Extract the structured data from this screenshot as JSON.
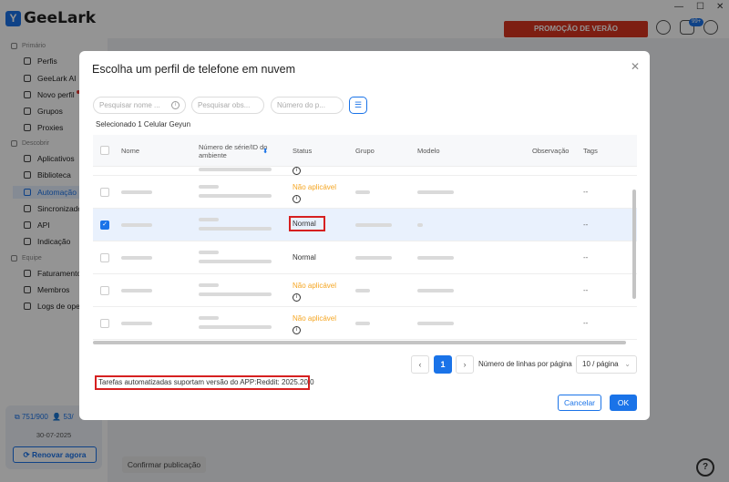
{
  "app": {
    "logo_text": "GeeLark",
    "promo_label": "PROMOÇÃO DE VERÃO",
    "notification_badge": "99+"
  },
  "sidebar": {
    "sections": [
      {
        "label": "Primário",
        "items": [
          "Perfis",
          "GeeLark AI",
          "Novo perfil",
          "Grupos",
          "Proxies"
        ]
      },
      {
        "label": "Descobrir",
        "items": [
          "Aplicativos",
          "Biblioteca",
          "Automação",
          "Sincronizador",
          "API",
          "Indicação"
        ]
      },
      {
        "label": "Equipe",
        "items": [
          "Faturamento",
          "Membros",
          "Logs de operações"
        ]
      }
    ],
    "quota_left": "751/900",
    "quota_right": "53/",
    "date": "30-07-2025",
    "renew_label": "Renovar agora"
  },
  "background": {
    "confirm_label": "Confirmar publicação"
  },
  "modal": {
    "title": "Escolha um perfil de telefone em nuvem",
    "filters": {
      "name_placeholder": "Pesquisar nome ...",
      "obs_placeholder": "Pesquisar obs...",
      "number_placeholder": "Número do p..."
    },
    "selected_text": "Selecionado 1 Celular Geyun",
    "columns": {
      "name": "Nome",
      "serial": "Número de série/ID do ambiente",
      "status": "Status",
      "group": "Grupo",
      "model": "Modelo",
      "observation": "Observação",
      "tags": "Tags"
    },
    "rows": [
      {
        "status": "Não aplicável",
        "status_type": "na",
        "tags": "--",
        "checked": false
      },
      {
        "status": "Normal",
        "status_type": "ok",
        "tags": "--",
        "checked": true
      },
      {
        "status": "Normal",
        "status_type": "ok",
        "tags": "--",
        "checked": false
      },
      {
        "status": "Não aplicável",
        "status_type": "na",
        "tags": "--",
        "checked": false
      },
      {
        "status": "Não aplicável",
        "status_type": "na",
        "tags": "--",
        "checked": false
      }
    ],
    "pagination": {
      "current_page": "1",
      "rows_per_page_label": "Número de linhas por página",
      "rows_per_page_value": "10 / página"
    },
    "footnote": "Tarefas automatizadas suportam versão do APP:Reddit: 2025.20.0",
    "cancel_label": "Cancelar",
    "ok_label": "OK"
  }
}
